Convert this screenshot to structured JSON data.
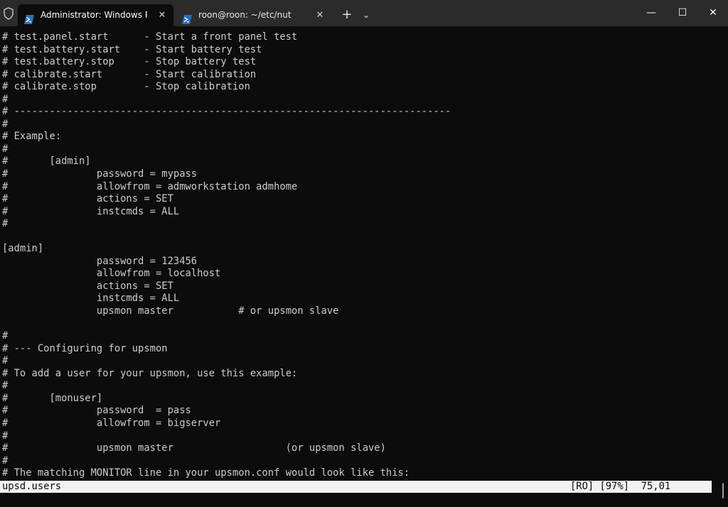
{
  "tabs": [
    {
      "label": "Administrator: Windows PowerShell",
      "close": "✕"
    },
    {
      "label": "roon@roon: ~/etc/nut",
      "close": "✕"
    }
  ],
  "tabbar": {
    "new_tab": "+",
    "dropdown": "⌄"
  },
  "window_controls": {
    "minimize": "—",
    "maximize": "☐",
    "close": "✕"
  },
  "terminal": {
    "lines": [
      "# test.panel.start      - Start a front panel test",
      "# test.battery.start    - Start battery test",
      "# test.battery.stop     - Stop battery test",
      "# calibrate.start       - Start calibration",
      "# calibrate.stop        - Stop calibration",
      "#",
      "# --------------------------------------------------------------------------",
      "#",
      "# Example:",
      "#",
      "#       [admin]",
      "#               password = mypass",
      "#               allowfrom = admworkstation admhome",
      "#               actions = SET",
      "#               instcmds = ALL",
      "#",
      "",
      "[admin]",
      "                password = 123456",
      "                allowfrom = localhost",
      "                actions = SET",
      "                instcmds = ALL",
      "                upsmon master           # or upsmon slave",
      "",
      "#",
      "# --- Configuring for upsmon",
      "#",
      "# To add a user for your upsmon, use this example:",
      "#",
      "#       [monuser]",
      "#               password  = pass",
      "#               allowfrom = bigserver",
      "#",
      "#               upsmon master                   (or upsmon slave)",
      "#",
      "# The matching MONITOR line in your upsmon.conf would look like this:"
    ]
  },
  "status": {
    "filename": "upsd.users",
    "position": "[RO] [97%]  75,01"
  },
  "colors": {
    "background": "#0c0c0c",
    "foreground": "#cccccc",
    "tabbar": "#2b2b2b",
    "powershell_icon": "#2671be",
    "statusbar": "#f2f2f2"
  }
}
